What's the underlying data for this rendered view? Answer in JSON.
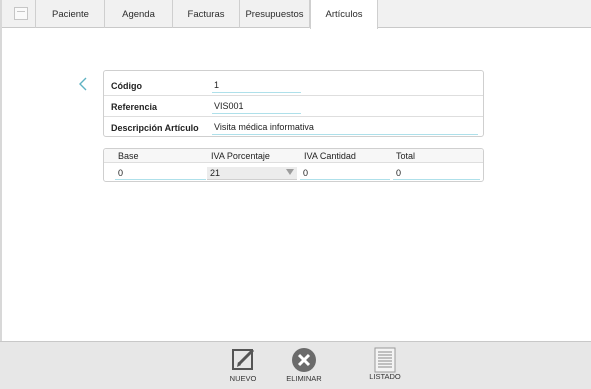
{
  "tabs": [
    {
      "label": "Paciente",
      "active": false
    },
    {
      "label": "Agenda",
      "active": false
    },
    {
      "label": "Facturas",
      "active": false
    },
    {
      "label": "Presupuestos",
      "active": false
    },
    {
      "label": "Artículos",
      "active": true
    }
  ],
  "article": {
    "codigo_label": "Código",
    "codigo_value": "1",
    "referencia_label": "Referencia",
    "referencia_value": "VIS001",
    "descripcion_label": "Descripción Artículo",
    "descripcion_value": "Visita médica informativa"
  },
  "pricing": {
    "base_label": "Base",
    "iva_porcentaje_label": "IVA Porcentaje",
    "iva_cantidad_label": "IVA Cantidad",
    "total_label": "Total",
    "base_value": "0",
    "iva_porcentaje_value": "21",
    "iva_cantidad_value": "0",
    "total_value": "0"
  },
  "toolbar": {
    "nuevo_label": "NUEVO",
    "eliminar_label": "ELIMINAR",
    "listado_label": "LISTADO"
  },
  "colors": {
    "accent": "#5fb3c3",
    "field_underline": "#aee0ea",
    "toolbar_bg": "#e7e7e7"
  },
  "icons": {
    "home": "document-icon",
    "prev": "chevron-left-icon",
    "next": "chevron-right-icon",
    "nuevo": "edit-icon",
    "eliminar": "delete-icon",
    "listado": "list-icon"
  }
}
